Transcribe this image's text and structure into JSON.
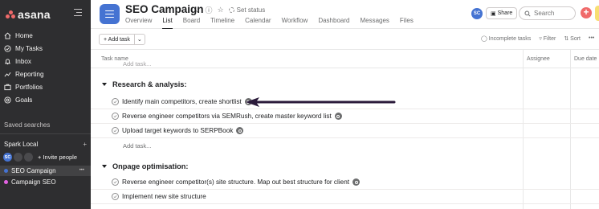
{
  "app": {
    "logo_text": "asana"
  },
  "sidebar": {
    "nav": [
      {
        "label": "Home",
        "icon": "home-icon"
      },
      {
        "label": "My Tasks",
        "icon": "check-circle-icon"
      },
      {
        "label": "Inbox",
        "icon": "bell-icon"
      },
      {
        "label": "Reporting",
        "icon": "reporting-icon"
      },
      {
        "label": "Portfolios",
        "icon": "portfolio-icon"
      },
      {
        "label": "Goals",
        "icon": "goal-icon"
      }
    ],
    "saved_searches": "Saved searches",
    "team": {
      "name": "Spark Local",
      "add": "+"
    },
    "members": {
      "initials": "SC",
      "invite_label": "+ Invite people"
    },
    "projects": [
      {
        "label": "SEO Campaign",
        "color": "#4573d2",
        "active": true
      },
      {
        "label": "Campaign SEO",
        "color": "#e362e3",
        "active": false
      }
    ]
  },
  "header": {
    "title": "SEO Campaign",
    "set_status": "Set status",
    "tabs": [
      "Overview",
      "List",
      "Board",
      "Timeline",
      "Calendar",
      "Workflow",
      "Dashboard",
      "Messages",
      "Files"
    ],
    "active_tab": "List",
    "user_initials": "SC",
    "share_label": "Share",
    "search_placeholder": "Search",
    "accent": "#4573d2"
  },
  "toolbar": {
    "add_task_label": "+ Add task",
    "incomplete_label": "Incomplete tasks",
    "filter_label": "Filter",
    "sort_label": "Sort"
  },
  "table": {
    "columns": [
      "Task name",
      "Assignee",
      "Due date"
    ],
    "cut_off_text": "Add task...",
    "sections": [
      {
        "name": "Research & analysis:",
        "tasks": [
          "Identify main competitors, create shortlist",
          "Reverse engineer competitors via SEMRush, create master keyword list",
          "Upload target keywords to SERPBook"
        ],
        "add_task": "Add task..."
      },
      {
        "name": "Onpage optimisation:",
        "tasks": [
          "Reverse engineer competitor(s) site structure. Map out best structure for client",
          "Implement new site structure"
        ]
      }
    ]
  },
  "annotation": {
    "arrow_color": "#2a1a3a"
  }
}
